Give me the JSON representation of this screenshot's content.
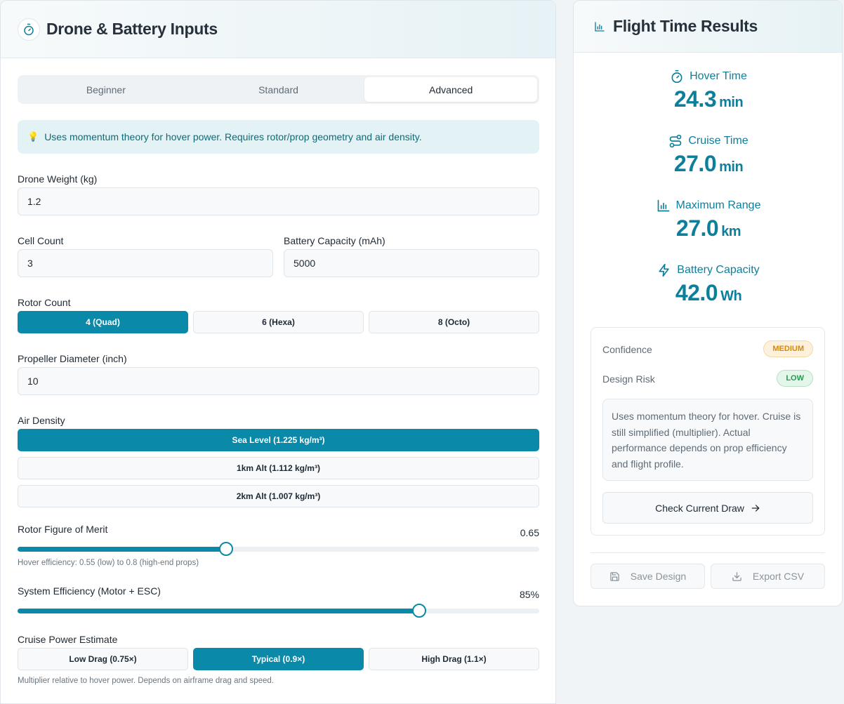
{
  "inputs_panel": {
    "title": "Drone & Battery Inputs",
    "icon": "stopwatch-icon",
    "mode_tabs": [
      {
        "label": "Beginner",
        "active": false
      },
      {
        "label": "Standard",
        "active": false
      },
      {
        "label": "Advanced",
        "active": true
      }
    ],
    "info_text": "Uses momentum theory for hover power. Requires rotor/prop geometry and air density.",
    "info_icon": "💡",
    "drone_weight": {
      "label": "Drone Weight (kg)",
      "value": "1.2"
    },
    "cell_count": {
      "label": "Cell Count",
      "value": "3"
    },
    "battery_capacity": {
      "label": "Battery Capacity (mAh)",
      "value": "5000"
    },
    "rotor_count": {
      "label": "Rotor Count",
      "options": [
        {
          "label": "4 (Quad)",
          "active": true
        },
        {
          "label": "6 (Hexa)",
          "active": false
        },
        {
          "label": "8 (Octo)",
          "active": false
        }
      ]
    },
    "propeller_diameter": {
      "label": "Propeller Diameter (inch)",
      "value": "10"
    },
    "air_density": {
      "label": "Air Density",
      "options": [
        {
          "label": "Sea Level (1.225 kg/m³)",
          "active": true
        },
        {
          "label": "1km Alt (1.112 kg/m³)",
          "active": false
        },
        {
          "label": "2km Alt (1.007 kg/m³)",
          "active": false
        }
      ]
    },
    "figure_of_merit": {
      "label": "Rotor Figure of Merit",
      "value_text": "0.65",
      "fraction": 0.4,
      "hint": "Hover efficiency: 0.55 (low) to 0.8 (high-end props)"
    },
    "system_efficiency": {
      "label": "System Efficiency (Motor + ESC)",
      "value_text": "85%",
      "fraction": 0.77
    },
    "cruise_power": {
      "label": "Cruise Power Estimate",
      "options": [
        {
          "label": "Low Drag (0.75×)",
          "active": false
        },
        {
          "label": "Typical (0.9×)",
          "active": true
        },
        {
          "label": "High Drag (1.1×)",
          "active": false
        }
      ],
      "hint": "Multiplier relative to hover power. Depends on airframe drag and speed."
    }
  },
  "results_panel": {
    "title": "Flight Time Results",
    "icon": "bar-chart-icon",
    "metrics": [
      {
        "label": "Hover Time",
        "value": "24.3",
        "unit": "min",
        "icon": "stopwatch-icon"
      },
      {
        "label": "Cruise Time",
        "value": "27.0",
        "unit": "min",
        "icon": "route-icon"
      },
      {
        "label": "Maximum Range",
        "value": "27.0",
        "unit": "km",
        "icon": "bar-chart-icon"
      },
      {
        "label": "Battery Capacity",
        "value": "42.0",
        "unit": "Wh",
        "icon": "lightning-icon"
      }
    ],
    "confidence": {
      "label": "Confidence",
      "badge": "MEDIUM"
    },
    "design_risk": {
      "label": "Design Risk",
      "badge": "LOW"
    },
    "note": "Uses momentum theory for hover. Cruise is still simplified (multiplier). Actual performance depends on prop efficiency and flight profile.",
    "check_button": "Check Current Draw",
    "save_button": "Save Design",
    "export_button": "Export CSV"
  },
  "colors": {
    "accent": "#0a89a8",
    "metric_text": "#0e7f9b",
    "badge_medium": "#d88a05",
    "badge_low": "#1f9b4f"
  }
}
